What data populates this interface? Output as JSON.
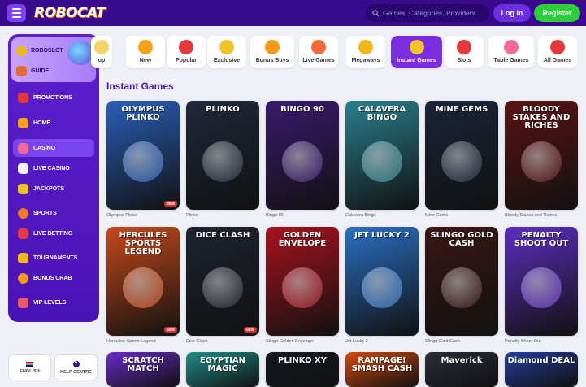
{
  "header": {
    "logo": "ROBOCAT",
    "search_placeholder": "Games, Categories, Providers",
    "login_label": "Log in",
    "register_label": "Register"
  },
  "sidebar": {
    "promo_items": [
      {
        "label": "ROBOSLOT",
        "icon": "coin-icon"
      },
      {
        "label": "GUIDE",
        "icon": "guide-icon"
      }
    ],
    "items": [
      {
        "label": "PROMOTIONS",
        "icon": "gift-icon",
        "active": false
      },
      {
        "label": "HOME",
        "icon": "home-icon",
        "active": false
      },
      {
        "label": "CASINO",
        "icon": "casino-icon",
        "active": true
      },
      {
        "label": "LIVE CASINO",
        "icon": "cards-icon",
        "active": false
      },
      {
        "label": "JACKPOTS",
        "icon": "jackpot-icon",
        "active": false
      },
      {
        "label": "SPORTS",
        "icon": "ball-icon",
        "active": false
      },
      {
        "label": "LIVE BETTING",
        "icon": "live-betting-icon",
        "active": false
      },
      {
        "label": "TOURNAMENTS",
        "icon": "trophy-icon",
        "active": false
      },
      {
        "label": "BONUS CRAB",
        "icon": "crab-icon",
        "active": false
      },
      {
        "label": "VIP LEVELS",
        "icon": "vip-icon",
        "active": false
      }
    ],
    "language_label": "ENGLISH",
    "help_label": "HELP CENTRE"
  },
  "categories": [
    {
      "label": "op",
      "icon": "partial-icon"
    },
    {
      "label": "New",
      "icon": "bell-icon"
    },
    {
      "label": "Popular",
      "icon": "star-icon"
    },
    {
      "label": "Exclusive",
      "icon": "gem-icon"
    },
    {
      "label": "Bonus Buys",
      "icon": "bag-icon"
    },
    {
      "label": "Live Games",
      "icon": "live-icon"
    },
    {
      "label": "Megaways",
      "icon": "megaways-icon"
    },
    {
      "label": "Instant Games",
      "icon": "trophy-icon",
      "active": true
    },
    {
      "label": "Slots",
      "icon": "slots-icon"
    },
    {
      "label": "Table Games",
      "icon": "dice-icon"
    },
    {
      "label": "All Games",
      "icon": "all-games-icon"
    }
  ],
  "section_title": "Instant Games",
  "games_row1": [
    {
      "title": "OLYMPUS PLINKO",
      "label": "Olympus Plinko",
      "new": true,
      "bg": "#2a5fb8"
    },
    {
      "title": "PLINKO",
      "label": "Plinko",
      "new": false,
      "bg": "#20283a"
    },
    {
      "title": "BINGO 90",
      "label": "Bingo 90",
      "new": false,
      "bg": "#3a1a6e"
    },
    {
      "title": "CALAVERA BINGO",
      "label": "Calavera Bingo",
      "new": false,
      "bg": "#2b7f8f"
    },
    {
      "title": "MINE GEMS",
      "label": "Mine Gems",
      "new": false,
      "bg": "#1b2438"
    },
    {
      "title": "BLOODY STAKES AND RICHES",
      "label": "Bloody Stakes and Riches",
      "new": false,
      "bg": "#5a1313"
    }
  ],
  "games_row2": [
    {
      "title": "HERCULES SPORTS LEGEND",
      "label": "Hercules: Sports Legend",
      "new": true,
      "bg": "#c54a1c"
    },
    {
      "title": "DICE CLASH",
      "label": "Dice Clash",
      "new": true,
      "bg": "#1e2330"
    },
    {
      "title": "GOLDEN ENVELOPE",
      "label": "Slingo Golden Envelope",
      "new": false,
      "bg": "#a8131e"
    },
    {
      "title": "JET LUCKY 2",
      "label": "Jet Lucky 2",
      "new": false,
      "bg": "#2b6fc4"
    },
    {
      "title": "SLINGO GOLD CASH",
      "label": "Slingo Gold Cash",
      "new": false,
      "bg": "#3b1616"
    },
    {
      "title": "PENALTY SHOOT OUT",
      "label": "Penalty Shoot Out",
      "new": false,
      "bg": "#5c2fbf"
    }
  ],
  "games_row3": [
    {
      "title": "SCRATCH MATCH",
      "bg": "#6b2bc9"
    },
    {
      "title": "EGYPTIAN MAGIC",
      "bg": "#1f8f8a"
    },
    {
      "title": "PLINKO XY",
      "bg": "#15181f"
    },
    {
      "title": "RAMPAGE! SMASH CASH",
      "bg": "#d24a10"
    },
    {
      "title": "Maverick",
      "bg": "#2b2e3a"
    },
    {
      "title": "Diamond DEAL",
      "bg": "#243e9c"
    }
  ],
  "colors": {
    "brand": "#3a0a8c",
    "accent": "#7a2ee0",
    "register": "#2ccf3a",
    "title": "#4a17b8"
  }
}
